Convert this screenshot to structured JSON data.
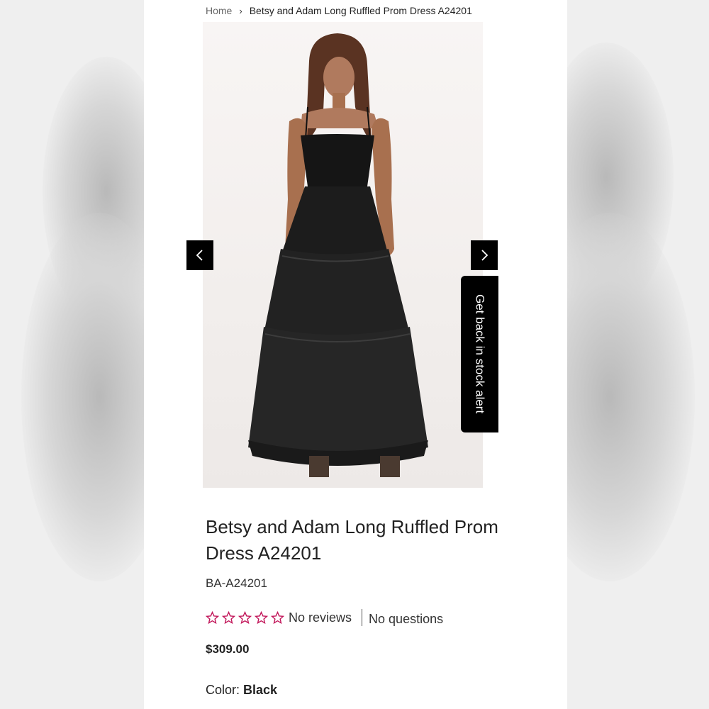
{
  "breadcrumb": {
    "home": "Home",
    "separator": "›",
    "current": "Betsy and Adam Long Ruffled Prom Dress A24201"
  },
  "gallery": {
    "image_alt": "Model wearing black tiered tulle long prom dress",
    "prev_icon": "chevron-left-icon",
    "next_icon": "chevron-right-icon"
  },
  "stock_alert": {
    "label": "Get back in stock alert"
  },
  "product": {
    "title": "Betsy and Adam Long Ruffled Prom Dress A24201",
    "sku": "BA-A24201",
    "rating": 0,
    "rating_max": 5,
    "reviews_label": "No reviews",
    "questions_label": "No questions",
    "price": "$309.00",
    "color_label": "Color:",
    "color_value": "Black"
  },
  "colors": {
    "star_outline": "#c2185b",
    "button_bg": "#000000",
    "text": "#222222"
  }
}
